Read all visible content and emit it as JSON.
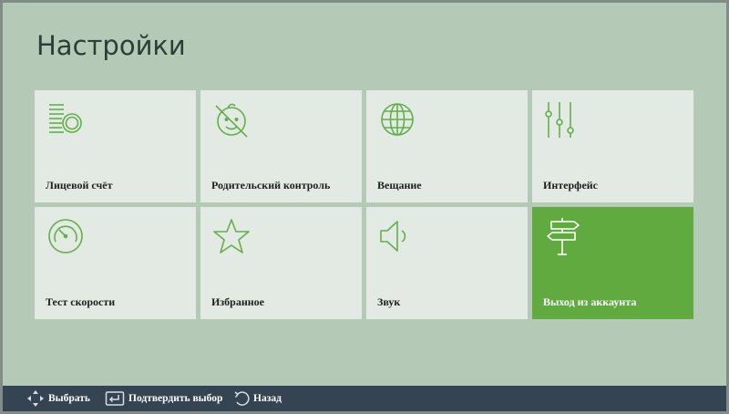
{
  "page": {
    "title": "Настройки"
  },
  "tiles": [
    {
      "label": "Лицевой счёт",
      "icon": "coins-icon"
    },
    {
      "label": "Родительский контроль",
      "icon": "child-restricted-icon"
    },
    {
      "label": "Вещание",
      "icon": "globe-icon"
    },
    {
      "label": "Интерфейс",
      "icon": "sliders-icon"
    },
    {
      "label": "Тест скорости",
      "icon": "speedometer-icon"
    },
    {
      "label": "Избранное",
      "icon": "star-icon"
    },
    {
      "label": "Звук",
      "icon": "speaker-icon"
    },
    {
      "label": "Выход из аккаунта",
      "icon": "signpost-icon",
      "selected": true
    }
  ],
  "hints": [
    {
      "label": "Выбрать",
      "icon": "dpad-arrows-icon"
    },
    {
      "label": "Подтвердить выбор",
      "icon": "enter-key-icon"
    },
    {
      "label": "Назад",
      "icon": "back-arrow-icon"
    }
  ],
  "colors": {
    "background": "#b5cab6",
    "tile": "#e3e9e3",
    "accent_green": "#60aa3f",
    "icon_stroke": "#62b04a",
    "bottom_bar": "#354452"
  }
}
